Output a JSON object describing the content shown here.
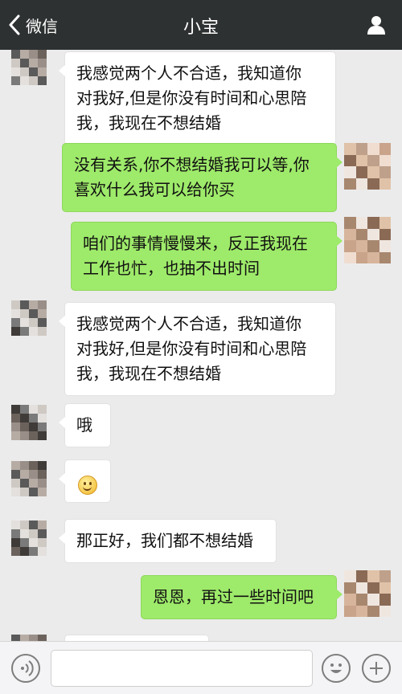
{
  "header": {
    "back_label": "微信",
    "title": "小宝"
  },
  "messages": [
    {
      "side": "in",
      "lines": [
        "我感觉两个人不合适，我知道你",
        "对我好,但是你没有时间和心思陪",
        "我，我现在不想结婚"
      ]
    },
    {
      "side": "out",
      "lines": [
        "没有关系,你不想结婚我可以等,你",
        "喜欢什么我可以给你买"
      ]
    },
    {
      "side": "out",
      "lines": [
        "咱们的事情慢慢来，反正我现在",
        "工作也忙，也抽不出时间"
      ]
    },
    {
      "side": "in",
      "lines": [
        "我感觉两个人不合适，我知道你",
        "对我好,但是你没有时间和心思陪",
        "我，我现在不想结婚"
      ]
    },
    {
      "side": "in",
      "lines": [
        "哦"
      ]
    },
    {
      "side": "in",
      "emoji": "smile-emoji"
    },
    {
      "side": "in",
      "lines": [
        "那正好，我们都不想结婚"
      ]
    },
    {
      "side": "out",
      "lines": [
        "恩恩，再过一些时间吧"
      ]
    }
  ],
  "input_bar": {
    "text_value": ""
  },
  "colors": {
    "header_bg": "#2e3132",
    "chat_bg": "#ebebeb",
    "outgoing_bubble": "#9eea6a",
    "incoming_bubble": "#ffffff"
  }
}
